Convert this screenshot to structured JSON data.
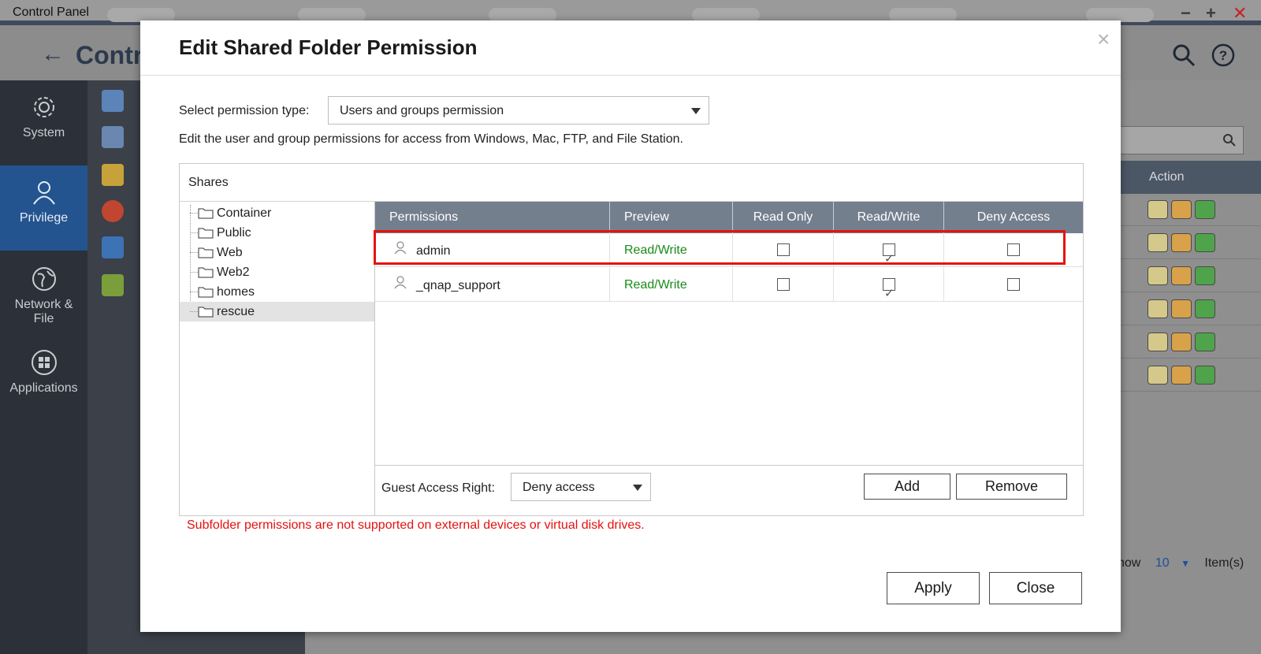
{
  "window": {
    "title": "Control Panel",
    "controls": [
      "−",
      "+",
      "✕"
    ]
  },
  "app": {
    "title": "Contr"
  },
  "sidebar": {
    "items": [
      {
        "label": "System",
        "icon": "gear-icon"
      },
      {
        "label": "Privilege",
        "icon": "user-icon"
      },
      {
        "label": "Network & File",
        "icon": "globe-icon"
      },
      {
        "label": "Applications",
        "icon": "apps-icon"
      }
    ]
  },
  "background": {
    "table_header_action": "Action",
    "footer_show": "how",
    "footer_count": "10",
    "footer_items": "Item(s)"
  },
  "dialog": {
    "title": "Edit Shared Folder Permission",
    "close_glyph": "×",
    "permission_type_label": "Select permission type:",
    "permission_type_value": "Users and groups permission",
    "description": "Edit the user and group permissions for access from Windows, Mac, FTP, and File Station.",
    "shares_label": "Shares",
    "shares": [
      "Container",
      "Public",
      "Web",
      "Web2",
      "homes",
      "rescue"
    ],
    "selected_share": "rescue",
    "columns": [
      "Permissions",
      "Preview",
      "Read Only",
      "Read/Write",
      "Deny Access"
    ],
    "rows": [
      {
        "name": "admin",
        "preview": "Read/Write",
        "read_only": false,
        "read_write": true,
        "deny": false
      },
      {
        "name": "_qnap_support",
        "preview": "Read/Write",
        "read_only": false,
        "read_write": true,
        "deny": false
      }
    ],
    "guest_label": "Guest Access Right:",
    "guest_value": "Deny access",
    "add_label": "Add",
    "remove_label": "Remove",
    "warning": "Subfolder permissions are not supported on external devices or virtual disk drives.",
    "apply_label": "Apply",
    "close_label": "Close"
  },
  "colors": {
    "accent": "#24548f",
    "grid_header": "#747f8e",
    "preview_text": "#1a8a1a",
    "warning_text": "#e51010",
    "highlight_border": "#e5140e"
  }
}
